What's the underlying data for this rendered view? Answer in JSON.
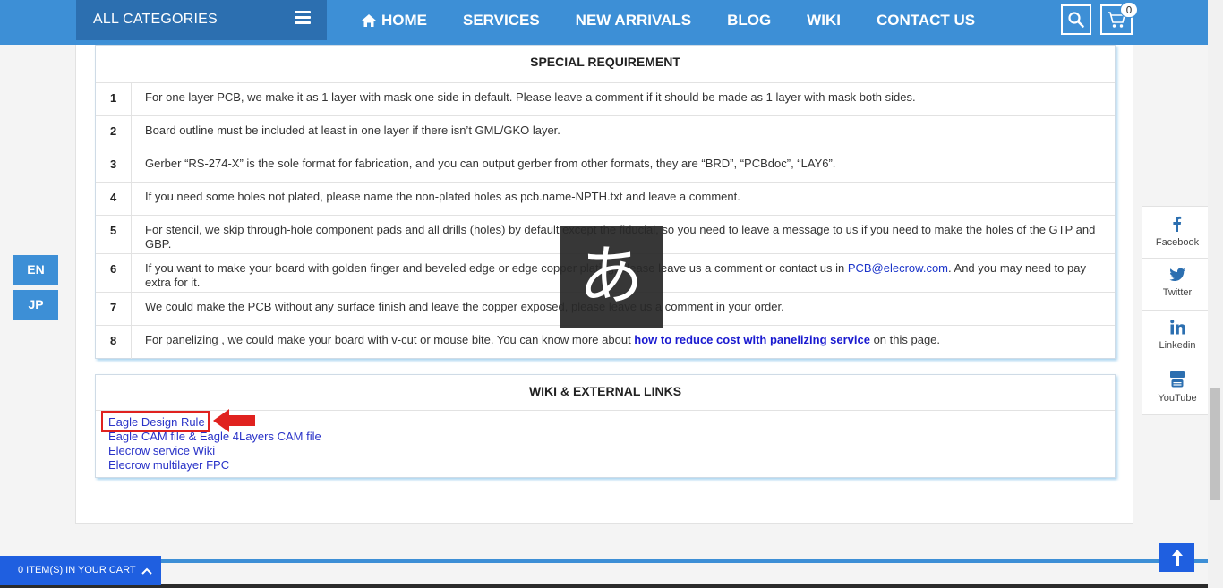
{
  "nav": {
    "categories_label": "ALL CATEGORIES",
    "items": [
      "HOME",
      "SERVICES",
      "NEW ARRIVALS",
      "BLOG",
      "WIKI",
      "CONTACT US"
    ],
    "cart_count": "0"
  },
  "requirements": {
    "title": "SPECIAL REQUIREMENT",
    "rows": [
      {
        "num": "1",
        "text": "For one layer PCB, we make it as 1 layer with mask one side in default. Please leave a comment if it should be made as 1 layer with mask both sides."
      },
      {
        "num": "2",
        "text": "Board outline must be included at least in one layer if there isn’t GML/GKO layer."
      },
      {
        "num": "3",
        "text": "Gerber “RS-274-X” is the sole format for fabrication, and you can output gerber from other formats, they are “BRD”, “PCBdoc”, “LAY6”."
      },
      {
        "num": "4",
        "text": "If you need some holes not plated, please name the non-plated holes as pcb.name-NPTH.txt and leave a comment."
      },
      {
        "num": "5",
        "text": "For stencil, we skip through-hole component pads and all drills (holes) by default except the fiducial, so you need to leave a message to us if you need to make the holes of the GTP and GBP."
      },
      {
        "num": "6",
        "text_before": "If you want to make your board with golden finger and beveled edge or edge copper plating, please leave us a comment or contact us in ",
        "link": "PCB@elecrow.com",
        "text_after": ". And you may need to pay extra for it."
      },
      {
        "num": "7",
        "text": "We could make the PCB without any surface finish and leave the copper exposed, please leave us a comment in your order."
      },
      {
        "num": "8",
        "text_before": "For panelizing , we could make your board with v-cut or mouse bite. You can know more about ",
        "link": "how to reduce cost with panelizing service",
        "text_after": " on this page."
      }
    ]
  },
  "links": {
    "title": "WIKI & EXTERNAL LINKS",
    "items": [
      "Eagle Design Rule",
      "Eagle CAM file & Eagle 4Layers CAM file",
      "Elecrow service Wiki",
      "Elecrow multilayer FPC"
    ]
  },
  "languages": [
    "EN",
    "JP"
  ],
  "social": [
    {
      "label": "Facebook",
      "icon": "facebook-icon"
    },
    {
      "label": "Twitter",
      "icon": "twitter-icon"
    },
    {
      "label": "Linkedin",
      "icon": "linkedin-icon"
    },
    {
      "label": "YouTube",
      "icon": "youtube-icon"
    }
  ],
  "ime_char": "あ",
  "cart_bar": "0 ITEM(S) IN YOUR CART",
  "colors": {
    "primary": "#3d8fd6",
    "dark_primary": "#2c6fb0",
    "cart_blue": "#1f5fe0",
    "link": "#2a33c8",
    "highlight_red": "#e0221f"
  }
}
